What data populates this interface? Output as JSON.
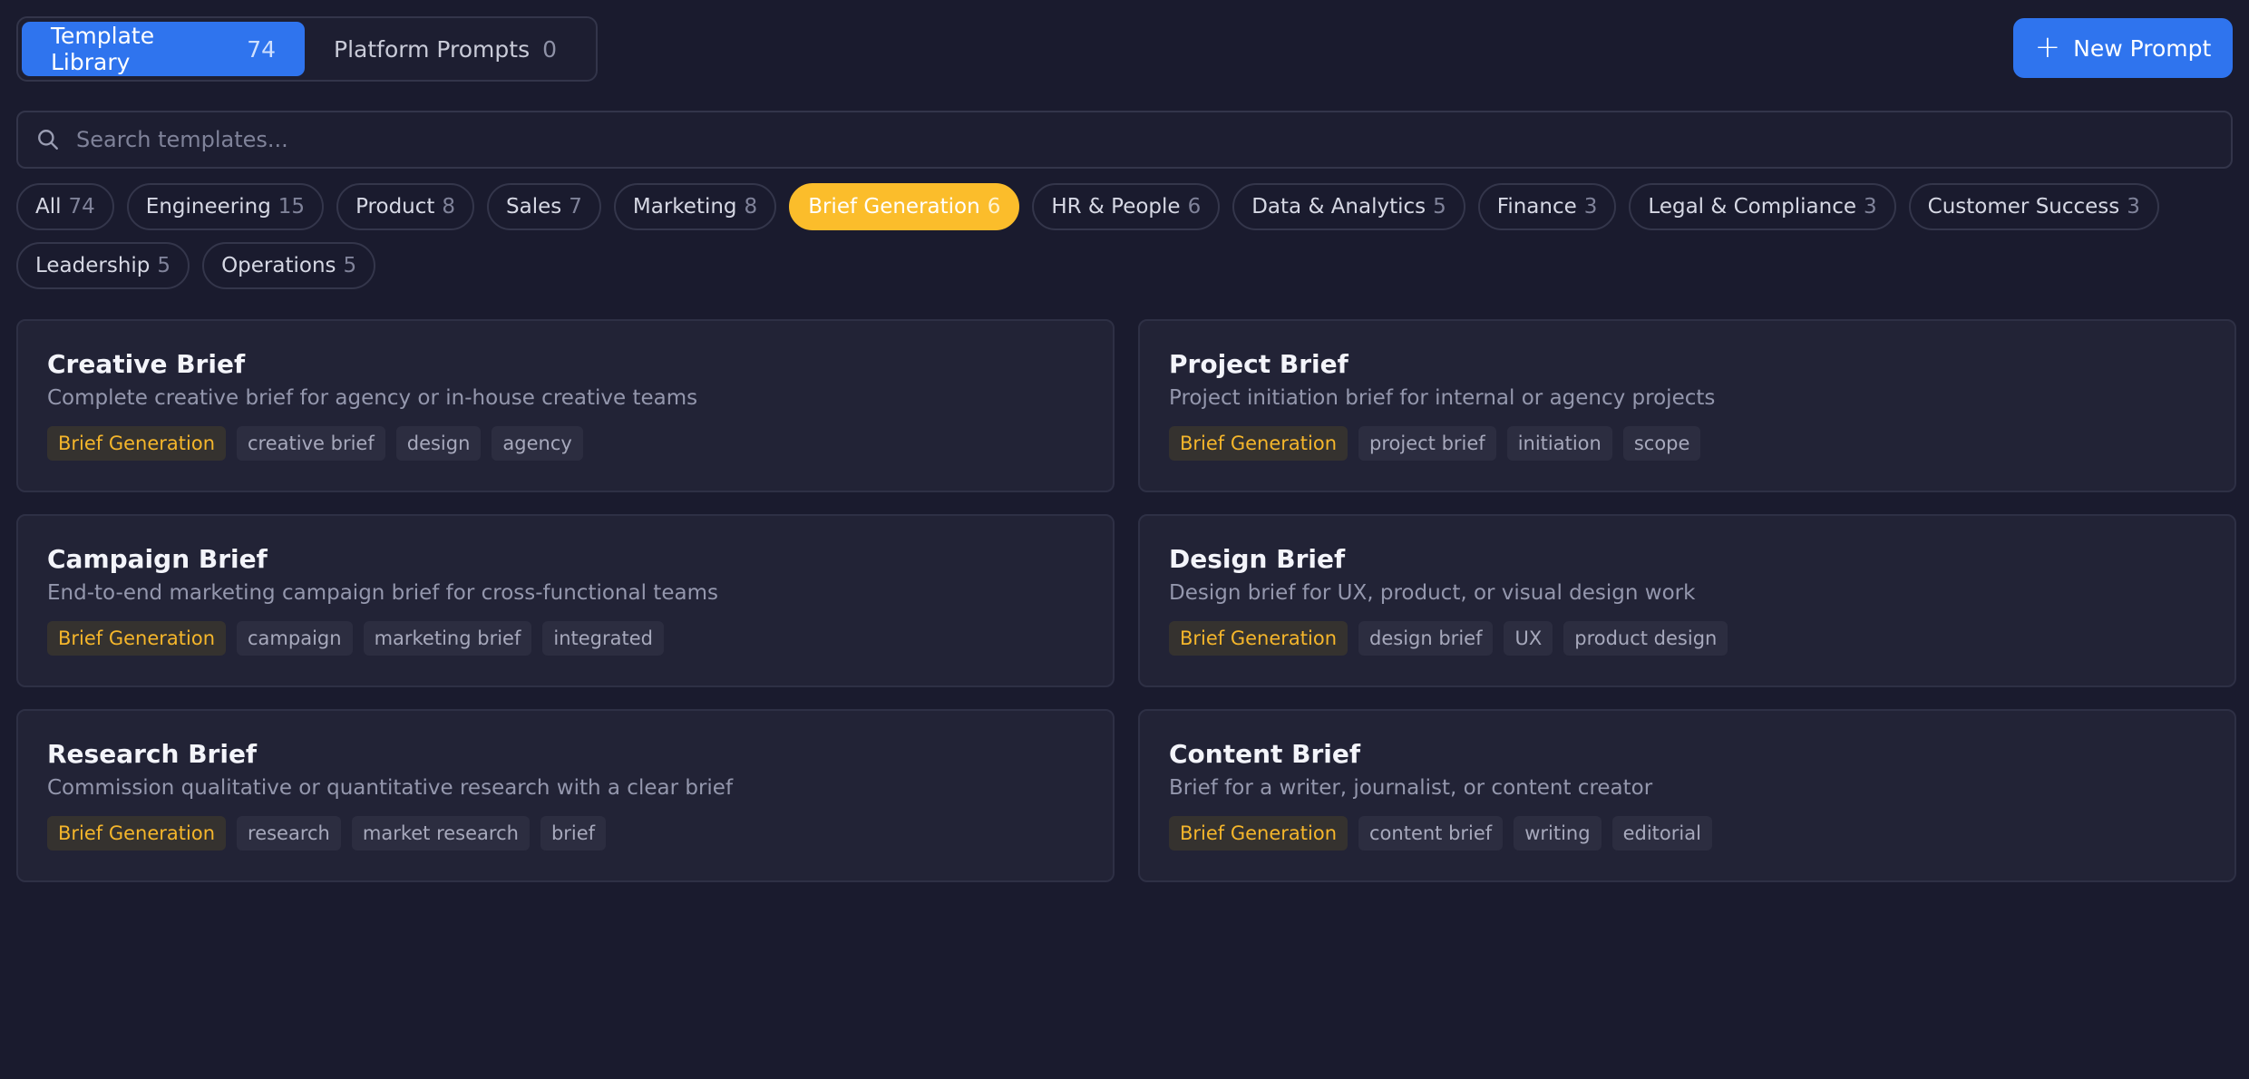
{
  "tabs": [
    {
      "label": "Template Library",
      "count": "74"
    },
    {
      "label": "Platform Prompts",
      "count": "0"
    }
  ],
  "new_button": {
    "label": "New Prompt",
    "icon": "plus-icon"
  },
  "search": {
    "placeholder": "Search templates...",
    "value": "",
    "icon": "search-icon"
  },
  "filters": [
    {
      "label": "All",
      "count": "74"
    },
    {
      "label": "Engineering",
      "count": "15"
    },
    {
      "label": "Product",
      "count": "8"
    },
    {
      "label": "Sales",
      "count": "7"
    },
    {
      "label": "Marketing",
      "count": "8"
    },
    {
      "label": "Brief Generation",
      "count": "6",
      "active": true
    },
    {
      "label": "HR & People",
      "count": "6"
    },
    {
      "label": "Data & Analytics",
      "count": "5"
    },
    {
      "label": "Finance",
      "count": "3"
    },
    {
      "label": "Legal & Compliance",
      "count": "3"
    },
    {
      "label": "Customer Success",
      "count": "3"
    },
    {
      "label": "Leadership",
      "count": "5"
    },
    {
      "label": "Operations",
      "count": "5"
    }
  ],
  "cards": [
    {
      "title": "Creative Brief",
      "description": "Complete creative brief for agency or in-house creative teams",
      "category": "Brief Generation",
      "tags": [
        "creative brief",
        "design",
        "agency"
      ]
    },
    {
      "title": "Project Brief",
      "description": "Project initiation brief for internal or agency projects",
      "category": "Brief Generation",
      "tags": [
        "project brief",
        "initiation",
        "scope"
      ]
    },
    {
      "title": "Campaign Brief",
      "description": "End-to-end marketing campaign brief for cross-functional teams",
      "category": "Brief Generation",
      "tags": [
        "campaign",
        "marketing brief",
        "integrated"
      ]
    },
    {
      "title": "Design Brief",
      "description": "Design brief for UX, product, or visual design work",
      "category": "Brief Generation",
      "tags": [
        "design brief",
        "UX",
        "product design"
      ]
    },
    {
      "title": "Research Brief",
      "description": "Commission qualitative or quantitative research with a clear brief",
      "category": "Brief Generation",
      "tags": [
        "research",
        "market research",
        "brief"
      ]
    },
    {
      "title": "Content Brief",
      "description": "Brief for a writer, journalist, or content creator",
      "category": "Brief Generation",
      "tags": [
        "content brief",
        "writing",
        "editorial"
      ]
    }
  ],
  "colors": {
    "background": "#1a1b2e",
    "accent_blue": "#2f74ee",
    "accent_yellow": "#fbbd2b"
  }
}
